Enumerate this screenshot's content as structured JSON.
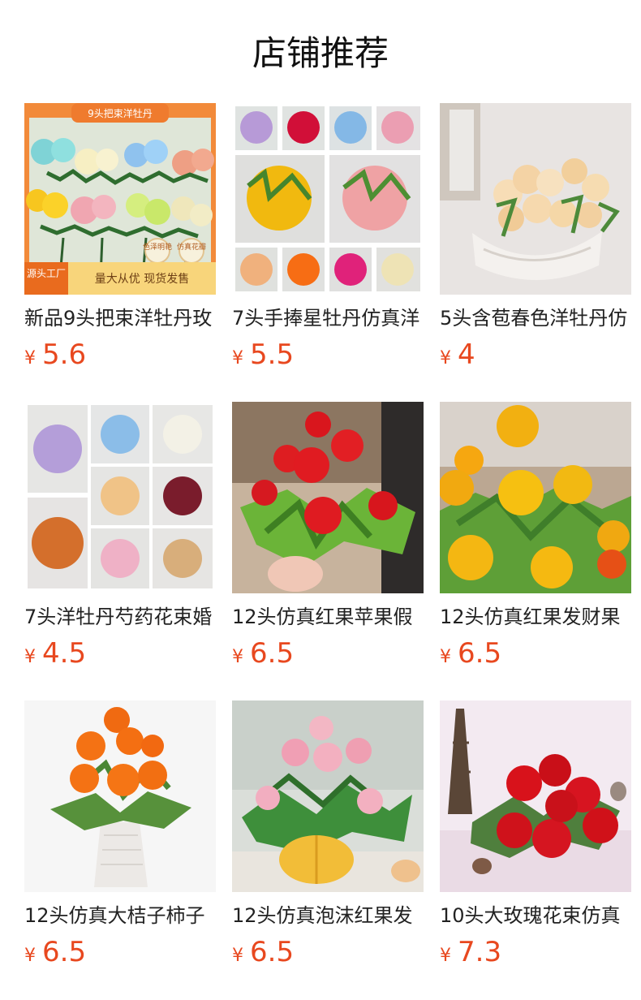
{
  "header": {
    "title": "店铺推荐"
  },
  "colors": {
    "price": "#e8481f",
    "text": "#222222",
    "background": "#ffffff"
  },
  "products": [
    {
      "name": "新品9头把束洋牡丹玫",
      "currency": "¥",
      "price": "5.6",
      "image_badge": "9头把束洋牡丹",
      "image_tag_source": "源头工厂",
      "image_banner": "量大从优 现货发售",
      "image_stamp_left": "色泽明艳",
      "image_stamp_right": "仿真花瓣"
    },
    {
      "name": "7头手捧星牡丹仿真洋",
      "currency": "¥",
      "price": "5.5"
    },
    {
      "name": "5头含苞春色洋牡丹仿",
      "currency": "¥",
      "price": "4"
    },
    {
      "name": "7头洋牡丹芍药花束婚",
      "currency": "¥",
      "price": "4.5"
    },
    {
      "name": "12头仿真红果苹果假",
      "currency": "¥",
      "price": "6.5"
    },
    {
      "name": "12头仿真红果发财果",
      "currency": "¥",
      "price": "6.5"
    },
    {
      "name": "12头仿真大桔子柿子",
      "currency": "¥",
      "price": "6.5"
    },
    {
      "name": "12头仿真泡沫红果发",
      "currency": "¥",
      "price": "6.5"
    },
    {
      "name": "10头大玫瑰花束仿真",
      "currency": "¥",
      "price": "7.3"
    }
  ]
}
